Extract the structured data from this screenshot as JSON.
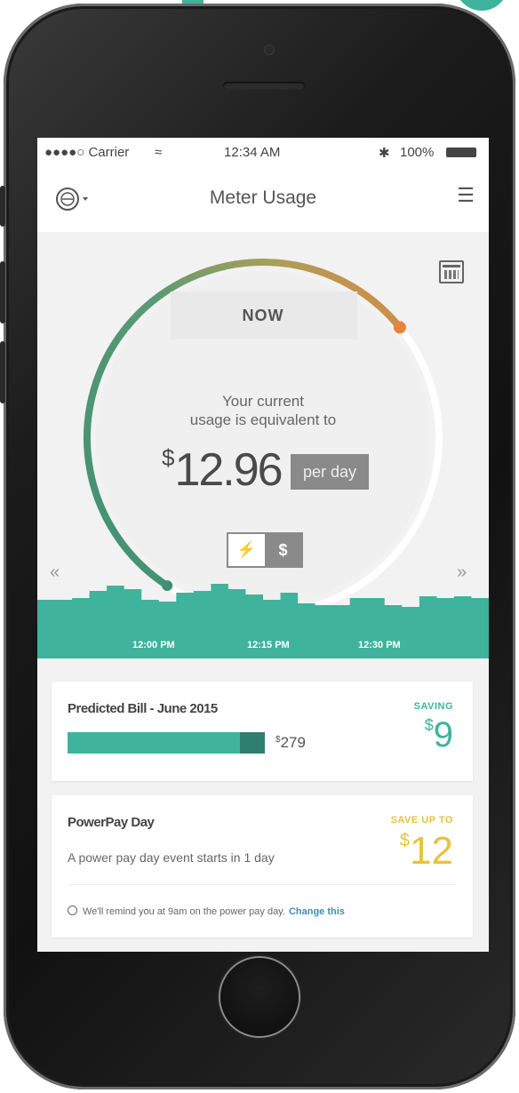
{
  "status_bar": {
    "carrier": "●●●●○ Carrier",
    "wifi": "≈",
    "time": "12:34 AM",
    "bluetooth": "✱",
    "battery": "100%"
  },
  "nav": {
    "title": "Meter Usage",
    "menu_glyph": "☰"
  },
  "meter": {
    "now_label": "NOW",
    "usage_line1": "Your current",
    "usage_line2": "usage is equivalent to",
    "price_symbol": "$",
    "price_value": "12.96",
    "period_label": "per day",
    "toggle_bolt": "⚡",
    "toggle_dollar": "$",
    "arrow_left": "«",
    "arrow_right": "»",
    "gauge_progress": 0.55,
    "colors": {
      "green": "#3f8f74",
      "orange": "#e8823d",
      "teal": "#3fb39b"
    }
  },
  "chart": {
    "time_labels": [
      "12:00 PM",
      "12:15 PM",
      "12:30 PM"
    ]
  },
  "predicted_bill": {
    "title": "Predicted Bill - June 2015",
    "amount_symbol": "$",
    "amount_value": "279",
    "saving_label": "SAVING",
    "saving_symbol": "$",
    "saving_value": "9"
  },
  "power_pay_day": {
    "title": "PowerPay Day",
    "description": "A power pay day event starts in 1 day",
    "save_label": "SAVE UP TO",
    "save_symbol": "$",
    "save_value": "12",
    "reminder_text": "We'll remind you at 9am on the power pay day.",
    "change_link": "Change this"
  }
}
